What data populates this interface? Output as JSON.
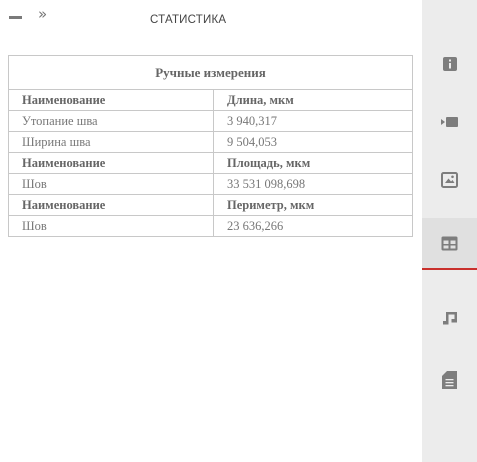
{
  "header": {
    "title": "СТАТИСТИКА",
    "minimize_icon": "minimize-icon",
    "expand_icon": "chevrons-right-icon",
    "expand_glyph": "»"
  },
  "table": {
    "caption": "Ручные измерения",
    "sections": [
      {
        "header": [
          "Наименование",
          "Длина, мкм"
        ],
        "rows": [
          [
            "Утопание шва",
            "3 940,317"
          ],
          [
            "Ширина шва",
            "9 504,053"
          ]
        ]
      },
      {
        "header": [
          "Наименование",
          "Площадь, мкм"
        ],
        "rows": [
          [
            "Шов",
            "33 531 098,698"
          ]
        ]
      },
      {
        "header": [
          "Наименование",
          "Периметр, мкм"
        ],
        "rows": [
          [
            "Шов",
            "23 636,266"
          ]
        ]
      }
    ]
  },
  "sidebar": {
    "items": [
      {
        "icon": "info-icon",
        "active": false
      },
      {
        "icon": "video-icon",
        "active": false
      },
      {
        "icon": "image-icon",
        "active": false
      },
      {
        "icon": "table-icon",
        "active": true
      },
      {
        "icon": "music-icon",
        "active": false
      },
      {
        "icon": "document-icon",
        "active": false
      }
    ],
    "accent_color": "#c9302c",
    "icon_color": "#7d7d7d"
  }
}
